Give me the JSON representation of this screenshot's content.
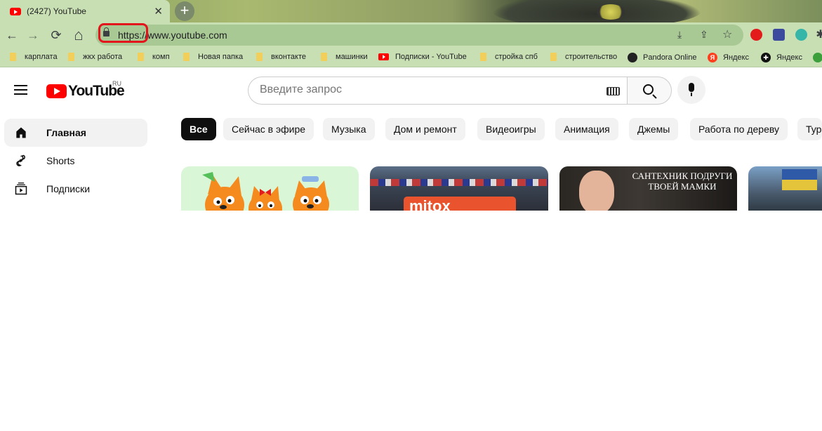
{
  "browser": {
    "tab_title": "(2427) YouTube",
    "tab_close": "✕",
    "new_tab": "+",
    "url_scheme": "https:",
    "url_rest": "//www.youtube.com",
    "nav": {
      "back": "←",
      "forward": "→",
      "reload": "⟳",
      "home": "⌂"
    }
  },
  "bookmarks": [
    {
      "label": "карплата",
      "icon": "folder-icon"
    },
    {
      "label": "жкх работа",
      "icon": "folder-icon"
    },
    {
      "label": "комп",
      "icon": "folder-icon"
    },
    {
      "label": "Новая папка",
      "icon": "folder-icon"
    },
    {
      "label": "вконтакте",
      "icon": "folder-icon"
    },
    {
      "label": "машинки",
      "icon": "folder-icon"
    },
    {
      "label": "Подписки - YouTube",
      "icon": "youtube-icon"
    },
    {
      "label": "стройка спб",
      "icon": "folder-icon"
    },
    {
      "label": "строительство",
      "icon": "folder-icon"
    },
    {
      "label": "Pandora Online",
      "icon": "pandora-icon"
    },
    {
      "label": "Яндекс",
      "icon": "yandex-icon"
    },
    {
      "label": "Яндекс",
      "icon": "yandex-plus-icon"
    }
  ],
  "youtube": {
    "logo_text": "YouTube",
    "country_code": "RU",
    "search_placeholder": "Введите запрос",
    "sidebar": [
      {
        "label": "Главная",
        "icon": "home-icon"
      },
      {
        "label": "Shorts",
        "icon": "shorts-icon"
      },
      {
        "label": "Подписки",
        "icon": "subscriptions-icon"
      }
    ],
    "chips": [
      "Все",
      "Сейчас в эфире",
      "Музыка",
      "Дом и ремонт",
      "Видеоигры",
      "Анимация",
      "Джемы",
      "Работа по дереву",
      "Тур"
    ],
    "thumbnails": [
      {
        "overlay_text": ""
      },
      {
        "overlay_text": "mitox"
      },
      {
        "overlay_text_line1": "САНТЕХНИК ПОДРУГИ",
        "overlay_text_line2": "ТВОЕЙ МАМКИ"
      },
      {
        "overlay_text": ""
      }
    ]
  },
  "colors": {
    "brand_red": "#ff0000",
    "chrome_green": "#c8dfb4",
    "annotation_red": "#e3141b"
  }
}
